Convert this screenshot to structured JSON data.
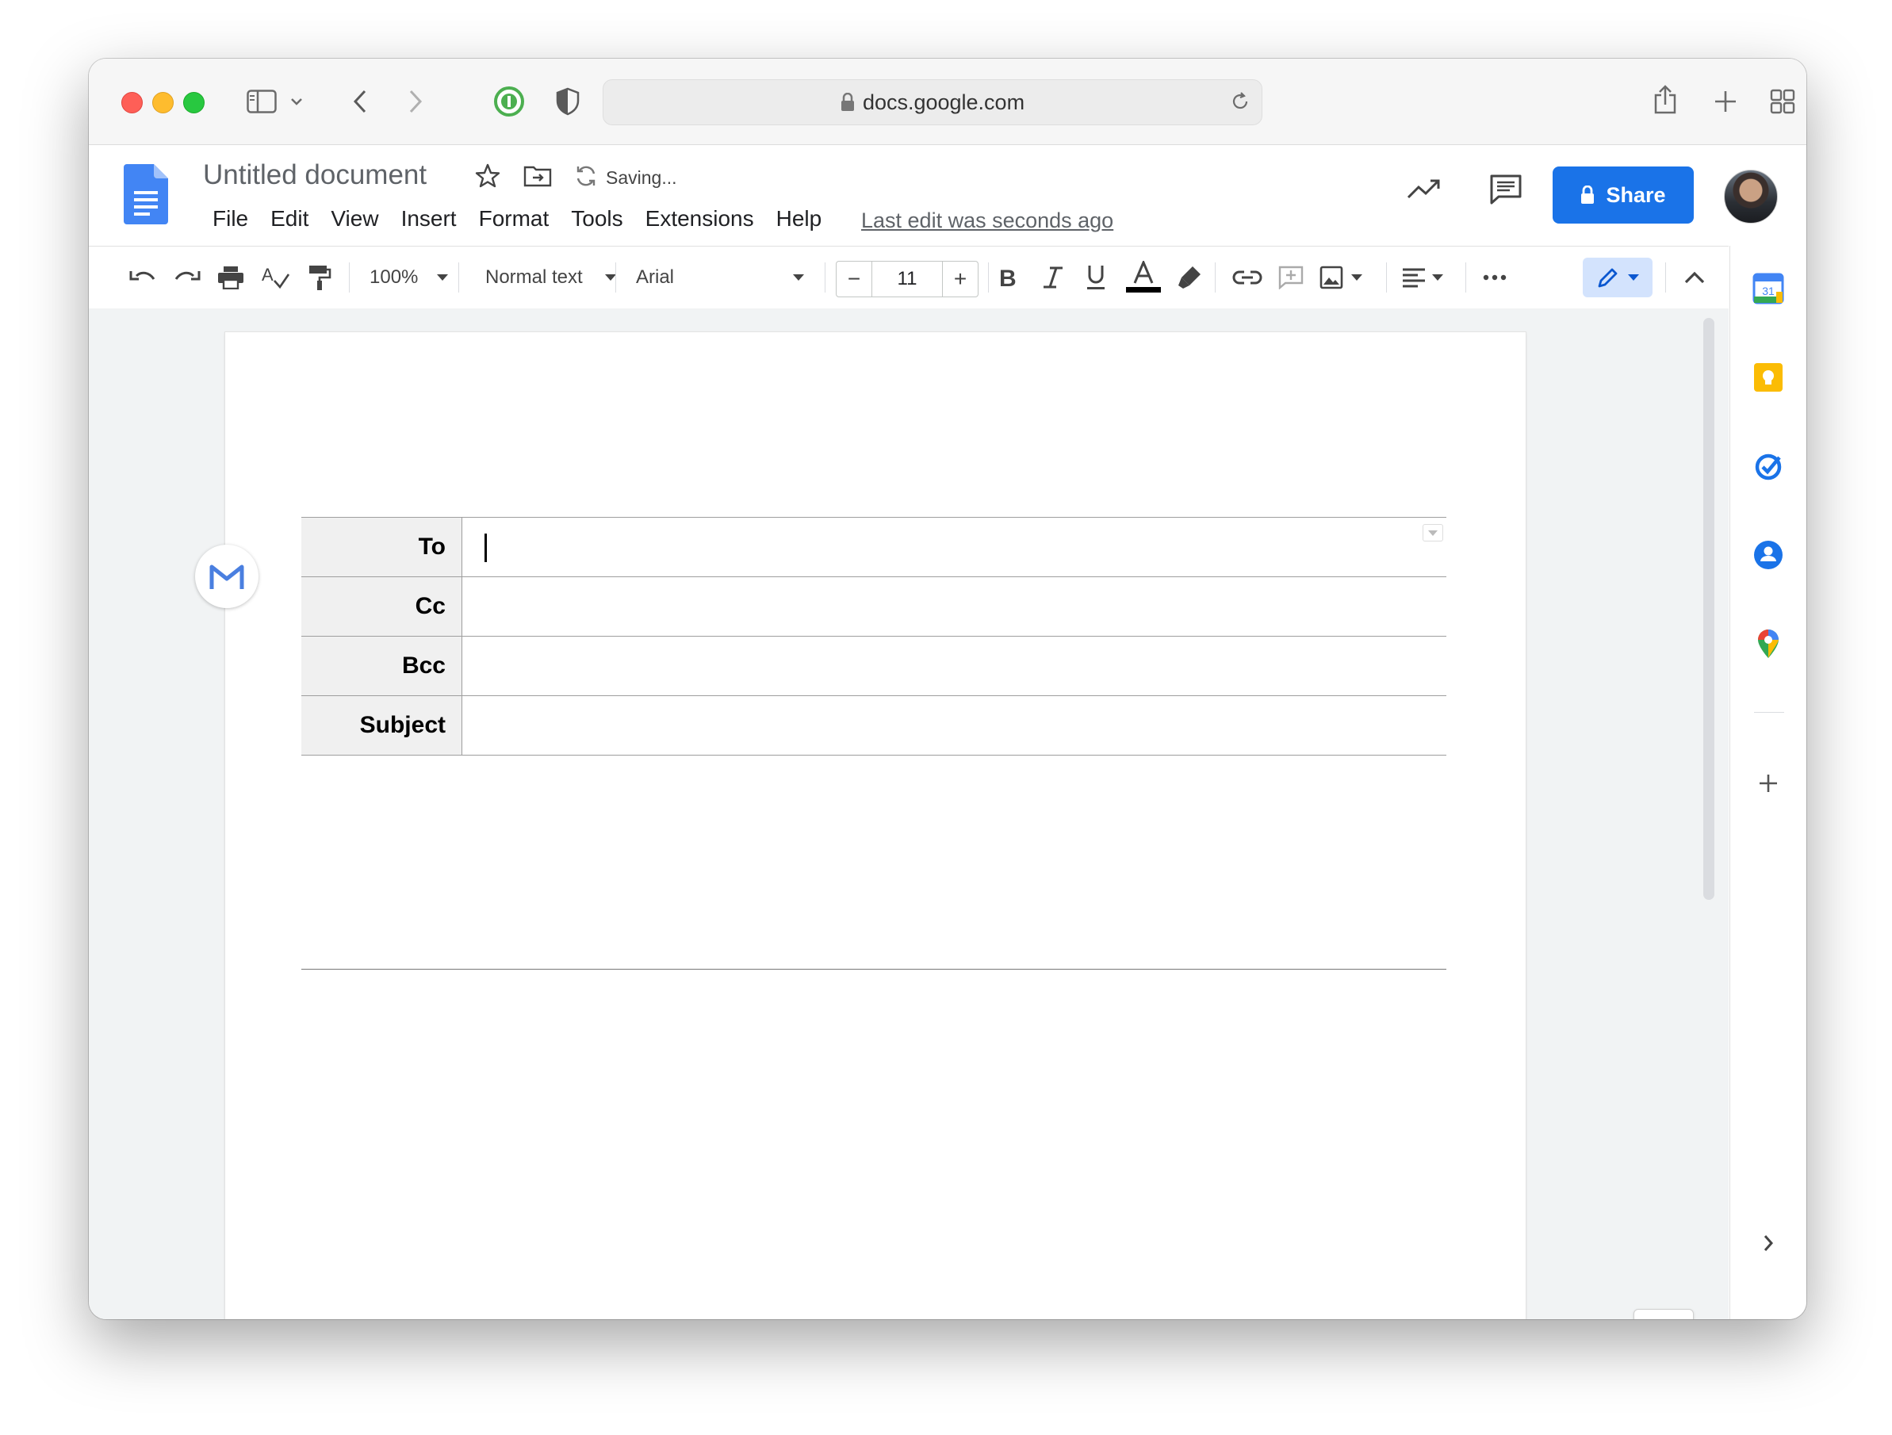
{
  "browser": {
    "url": "docs.google.com"
  },
  "doc": {
    "title": "Untitled document",
    "saving_status": "Saving...",
    "menu": [
      "File",
      "Edit",
      "View",
      "Insert",
      "Format",
      "Tools",
      "Extensions",
      "Help"
    ],
    "last_edit": "Last edit was seconds ago",
    "share_label": "Share"
  },
  "toolbar": {
    "zoom": "100%",
    "style": "Normal text",
    "font": "Arial",
    "font_size": "11",
    "minus": "−",
    "plus": "+"
  },
  "email_draft": {
    "rows": [
      {
        "label": "To",
        "value": ""
      },
      {
        "label": "Cc",
        "value": ""
      },
      {
        "label": "Bcc",
        "value": ""
      },
      {
        "label": "Subject",
        "value": ""
      }
    ]
  },
  "side_panel": {
    "calendar_day": "31",
    "icons": [
      "calendar-icon",
      "keep-icon",
      "tasks-icon",
      "contacts-icon",
      "maps-icon",
      "add-icon",
      "expand-icon"
    ]
  },
  "colors": {
    "accent": "#1a73e8",
    "docs_blue": "#4285f4"
  }
}
